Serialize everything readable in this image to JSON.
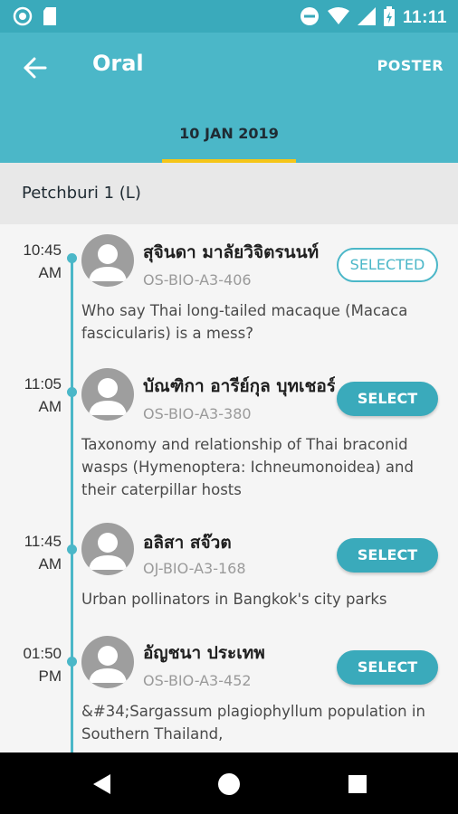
{
  "status_bar": {
    "time": "11:11",
    "left_icons": [
      "circle-notification-icon",
      "sd-card-icon"
    ],
    "right_icons": [
      "do-not-disturb-icon",
      "wifi-icon",
      "signal-icon",
      "battery-charging-icon"
    ]
  },
  "app_bar": {
    "title": "Oral",
    "action_label": "POSTER"
  },
  "tab": {
    "date": "10 JAN 2019",
    "indicator_color": "#f5c518"
  },
  "room": {
    "name": "Petchburi 1 (L)"
  },
  "sessions": [
    {
      "time": "10:45",
      "ampm": "AM",
      "speaker": "สุจินดา มาลัยวิจิตรนนท์",
      "code": "OS-BIO-A3-406",
      "abstract": "Who say Thai long-tailed macaque (Macaca fascicularis) is a mess?",
      "button_label": "SELECTED",
      "selected": true
    },
    {
      "time": "11:05",
      "ampm": "AM",
      "speaker": "บัณฑิกา อารีย์กุล บุทเชอร์",
      "code": "OS-BIO-A3-380",
      "abstract": "Taxonomy and relationship of Thai braconid wasps (Hymenoptera: Ichneumonoidea) and their caterpillar hosts",
      "button_label": "SELECT",
      "selected": false
    },
    {
      "time": "11:45",
      "ampm": "AM",
      "speaker": "อลิสา สจ๊วต",
      "code": "OJ-BIO-A3-168",
      "abstract": "Urban pollinators in Bangkok's city parks",
      "button_label": "SELECT",
      "selected": false
    },
    {
      "time": "01:50",
      "ampm": "PM",
      "speaker": "อัญชนา ประเทพ",
      "code": "OS-BIO-A3-452",
      "abstract": "&#34;Sargassum plagiophyllum population in Southern Thailand,",
      "button_label": "SELECT",
      "selected": false
    }
  ],
  "colors": {
    "primary": "#4bb7c8",
    "primary_dark": "#3aaabb",
    "accent": "#f5c518"
  },
  "nav_bar": {
    "icons": [
      "back-triangle-icon",
      "home-circle-icon",
      "recents-square-icon"
    ]
  }
}
